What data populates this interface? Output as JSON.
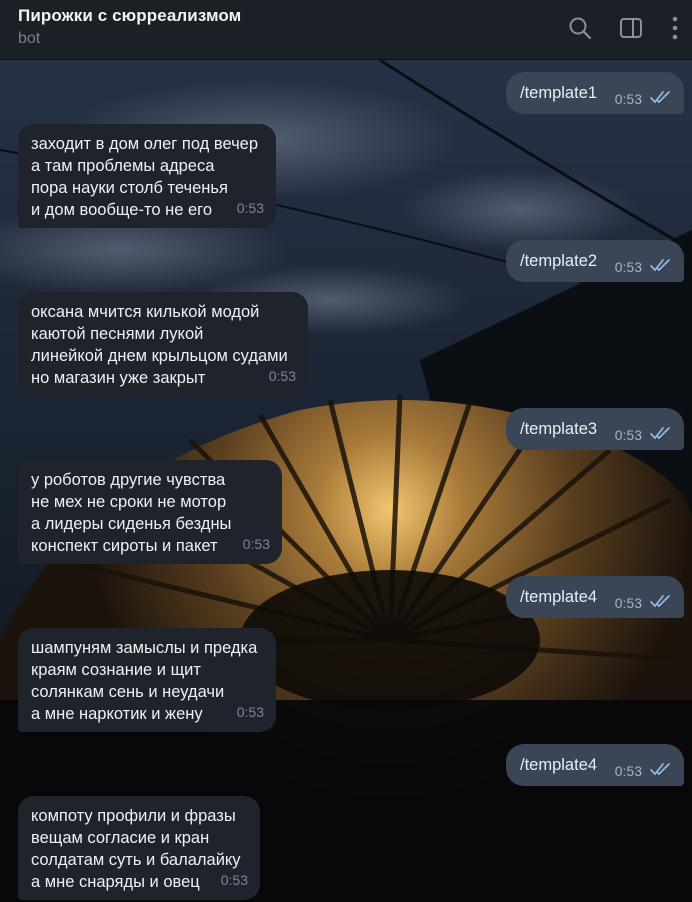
{
  "header": {
    "title": "Пирожки с сюрреализмом",
    "subtitle": "bot",
    "icons": [
      "search-icon",
      "sidebar-toggle-icon",
      "more-vertical-icon"
    ]
  },
  "messages": [
    {
      "dir": "out",
      "text": "/template1",
      "time": "0:53",
      "status": "read"
    },
    {
      "dir": "in",
      "lines": [
        "заходит в дом олег под вечер",
        "а там проблемы адреса",
        "пора науки столб теченья",
        "и дом вообще-то не его"
      ],
      "time": "0:53"
    },
    {
      "dir": "out",
      "text": "/template2",
      "time": "0:53",
      "status": "read"
    },
    {
      "dir": "in",
      "lines": [
        "оксана мчится килькой модой",
        "каютой песнями лукой",
        "линейкой днем крыльцом судами",
        "но магазин уже закрыт"
      ],
      "time": "0:53"
    },
    {
      "dir": "out",
      "text": "/template3",
      "time": "0:53",
      "status": "read"
    },
    {
      "dir": "in",
      "lines": [
        "у роботов другие чувства",
        "не мех не сроки не мотор",
        "а лидеры сиденья бездны",
        "конспект сироты и пакет"
      ],
      "time": "0:53"
    },
    {
      "dir": "out",
      "text": "/template4",
      "time": "0:53",
      "status": "read"
    },
    {
      "dir": "in",
      "lines": [
        "шампуням замыслы и предка",
        "краям сознание и щит",
        "солянкам сень и неудачи",
        "а мне наркотик и жену"
      ],
      "time": "0:53"
    },
    {
      "dir": "out",
      "text": "/template4",
      "time": "0:53",
      "status": "read"
    },
    {
      "dir": "in",
      "lines": [
        "компоту профили и фразы",
        "вещам согласие и кран",
        "солдатам суть и балалайку",
        "а мне снаряды и овец"
      ],
      "time": "0:53"
    }
  ],
  "colors": {
    "header_bg": "#1b1f26",
    "incoming_bubble": "#1f242c",
    "outgoing_bubble": "#3a4555",
    "read_ticks": "#8fb7e3"
  }
}
